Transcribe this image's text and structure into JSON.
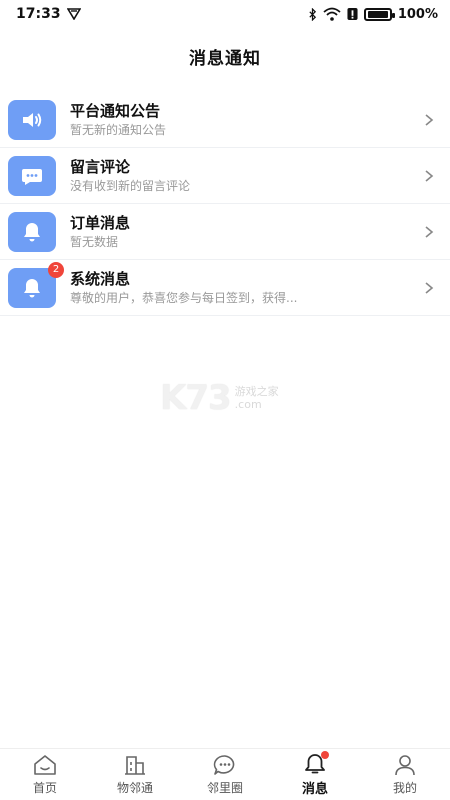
{
  "status": {
    "time": "17:33",
    "battery": "100%"
  },
  "header": {
    "title": "消息通知"
  },
  "items": [
    {
      "title": "平台通知公告",
      "subtitle": "暂无新的通知公告",
      "icon": "speaker-icon"
    },
    {
      "title": "留言评论",
      "subtitle": "没有收到新的留言评论",
      "icon": "chat-bubble-icon"
    },
    {
      "title": "订单消息",
      "subtitle": "暂无数据",
      "icon": "bell-icon"
    },
    {
      "title": "系统消息",
      "subtitle": "尊敬的用户，恭喜您参与每日签到，获得...",
      "icon": "bell-icon",
      "badge": "2"
    }
  ],
  "watermark": {
    "logo": "K73",
    "line1": "游戏之家",
    "line2": ".com"
  },
  "tabbar": {
    "tabs": [
      {
        "label": "首页",
        "icon": "home-icon"
      },
      {
        "label": "物邻通",
        "icon": "building-icon"
      },
      {
        "label": "邻里圈",
        "icon": "chat-icon"
      },
      {
        "label": "消息",
        "icon": "bell-icon",
        "active": true
      },
      {
        "label": "我的",
        "icon": "user-icon"
      }
    ]
  },
  "colors": {
    "accent": "#6f9ef5",
    "badge": "#f0453a"
  }
}
